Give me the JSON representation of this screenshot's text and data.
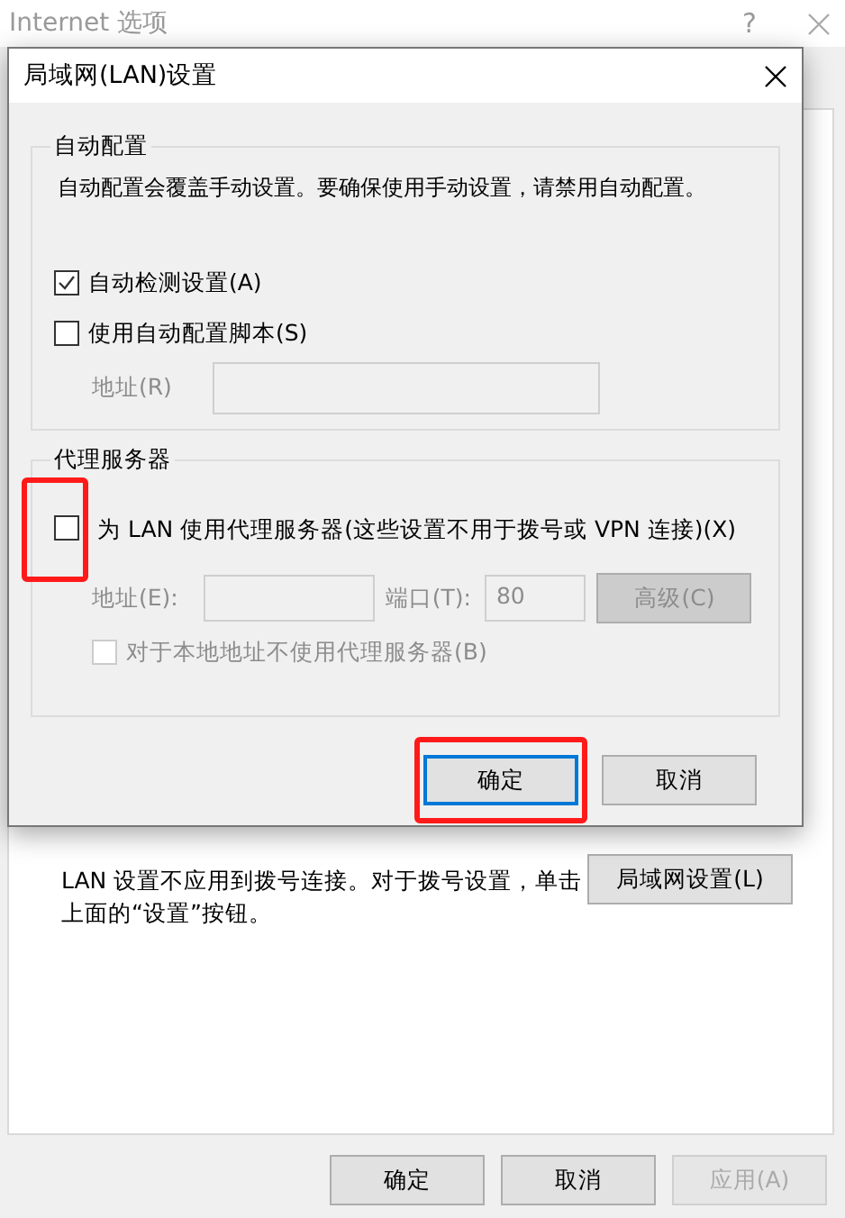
{
  "window": {
    "title": "Internet 选项",
    "help": "?"
  },
  "panel": {
    "description_lines": [
      "LAN 设置不应用到拨号连接。对于拨号设置，单击",
      "上面的“设置”按钮。"
    ],
    "lan_button": "局域网设置(L)"
  },
  "buttons": [
    {
      "label": "确定",
      "disabled": false
    },
    {
      "label": "取消",
      "disabled": false
    },
    {
      "label": "应用(A)",
      "disabled": true
    }
  ],
  "dialog": {
    "title": "局域网(LAN)设置",
    "auto_config": {
      "legend": "自动配置",
      "note": "自动配置会覆盖手动设置。要确保使用手动设置，请禁用自动配置。",
      "options": [
        {
          "label": "自动检测设置(A)",
          "checked": true,
          "disabled": false
        },
        {
          "label": "使用自动配置脚本(S)",
          "checked": false,
          "disabled": false
        }
      ],
      "address": {
        "label": "地址(R)",
        "disabled": true
      }
    },
    "proxy": {
      "legend": "代理服务器",
      "use_proxy": {
        "label": "为 LAN 使用代理服务器(这些设置不用于拨号或 VPN 连接)(X)",
        "checked": false,
        "disabled": false,
        "highlighted": true
      },
      "address": {
        "label": "地址(E):",
        "disabled": true
      },
      "port": {
        "label": "端口(T):",
        "value": "80",
        "disabled": true
      },
      "advanced_button": {
        "label": "高级(C)",
        "disabled": true
      },
      "bypass": {
        "label": "对于本地地址不使用代理服务器(B)",
        "checked": false,
        "disabled": true
      }
    },
    "buttons": [
      {
        "label": "确定",
        "default": true,
        "highlighted": true
      },
      {
        "label": "取消",
        "default": false,
        "highlighted": false
      }
    ]
  }
}
